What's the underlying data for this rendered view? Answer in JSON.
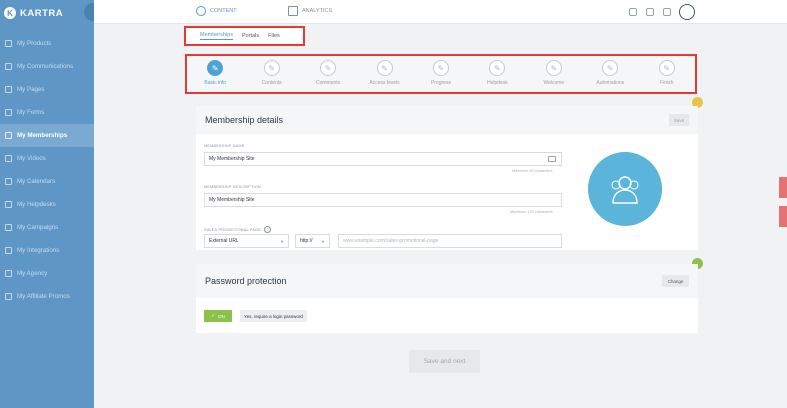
{
  "app": {
    "logo_text": "KARTRA"
  },
  "sidebar": {
    "items": [
      {
        "label": "My Products",
        "icon": "tag-icon"
      },
      {
        "label": "My Communications",
        "icon": "mail-icon"
      },
      {
        "label": "My Pages",
        "icon": "page-icon"
      },
      {
        "label": "My Forms",
        "icon": "form-icon"
      },
      {
        "label": "My Memberships",
        "icon": "membership-icon"
      },
      {
        "label": "My Videos",
        "icon": "video-icon"
      },
      {
        "label": "My Calendars",
        "icon": "calendar-icon"
      },
      {
        "label": "My Helpdesks",
        "icon": "helpdesk-icon"
      },
      {
        "label": "My Campaigns",
        "icon": "campaign-icon"
      },
      {
        "label": "My Integrations",
        "icon": "integration-icon"
      },
      {
        "label": "My Agency",
        "icon": "agency-icon"
      },
      {
        "label": "My Affiliate Promos",
        "icon": "affiliate-icon"
      }
    ],
    "active_index": 4
  },
  "topbar": {
    "content_tab": "CONTENT",
    "analytics_tab": "ANALYTICS"
  },
  "subtabs": [
    "Memberships",
    "Portals",
    "Files"
  ],
  "steps": [
    "Basic info",
    "Contents",
    "Comments",
    "Access levels",
    "Progress",
    "Helpdesk",
    "Welcome",
    "Automations",
    "Finish"
  ],
  "membership": {
    "title": "Membership details",
    "save_label": "Save",
    "name_label": "MEMBERSHIP NAME",
    "name_value": "My Membership Site",
    "name_hint": "Maximum 45 characters",
    "description_label": "MEMBERSHIP DESCRIPTION",
    "description_value": "My Membership Site",
    "description_hint": "Maximum 120 characters",
    "sales_label": "SALES PROMOTIONAL PAGE",
    "help_glyph": "?",
    "sales_type": "External URL",
    "sales_protocol": "http://",
    "sales_placeholder": "www.example.com/sales-promotional-page"
  },
  "password": {
    "title": "Password protection",
    "change_label": "Change",
    "toggle_label": "ON",
    "option_label": "Yes, require a login password"
  },
  "footer": {
    "next_label": "Save and next"
  },
  "colors": {
    "sidebar": "#5e97c6",
    "accent": "#4da3d6",
    "highlight": "#e53935",
    "success": "#8bc34a"
  }
}
